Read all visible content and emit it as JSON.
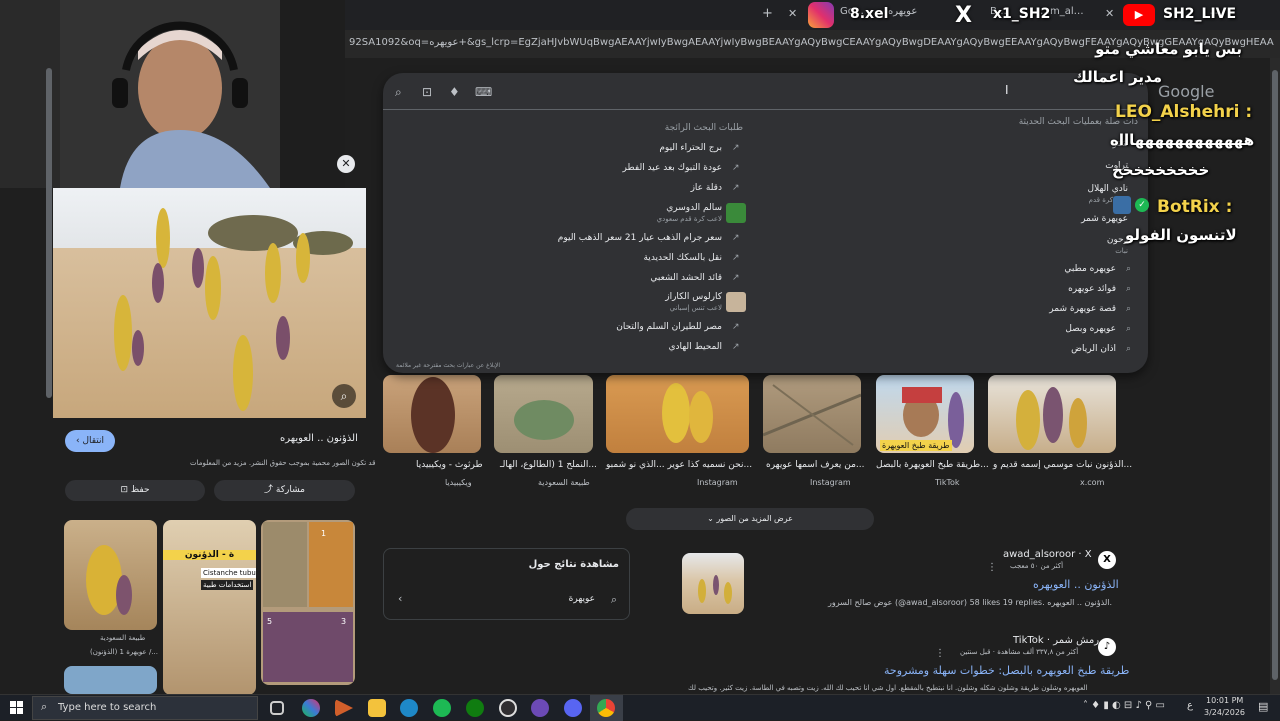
{
  "tabs": [
    {
      "label": "Go…"
    },
    {
      "label": "عويهره"
    },
    {
      "label": "B…"
    },
    {
      "label": "…m_al…"
    }
  ],
  "url": "92SA1092&oq=عويهره+&gs_lcrp=EgZjaHJvbWUqBwgAEAAYjwIyBwgAEAAYjwIyBwgBEAAYgAQyBwgCEAAYgAQyBwgDEAAYgAQyBwgEEAAYgAQyBwgFEAAYgAQyBwgGEAAYgAQyBwgHEAA",
  "stream_overlay": {
    "instagram": "8.xel",
    "x": "x1_SH2",
    "youtube": "SH2_LIVE",
    "chat": [
      {
        "text": "بس يابو معاشي متو"
      },
      {
        "text": "مدير اعمالك"
      },
      {
        "user": "LEO_Alshehri :",
        "text": "ههههههههههههاااه"
      },
      {
        "text": "خخخخخخخخخ"
      },
      {
        "user": "BotRix :",
        "text": "لاتنسون الفولو"
      }
    ],
    "google_watermark": "Google"
  },
  "suggestions": {
    "header_trending": "طلبات البحث الرائجة",
    "header_recent": "ذات صلة بعمليات البحث الحديثة",
    "trending": [
      {
        "text": "برج الحتراء اليوم"
      },
      {
        "text": "عودة التبوك بعد عيد الفطر"
      },
      {
        "text": "دقلة عاز"
      },
      {
        "text": "سالم الدوسري",
        "sub": "لاعب كرة قدم سعودي"
      },
      {
        "text": "سعر جرام الذهب عيار 21 سعر الذهب اليوم"
      },
      {
        "text": "نقل بالسكك الحديدية"
      },
      {
        "text": "قائد الحشد الشعبي"
      },
      {
        "text": "كارلوس الكاراز",
        "sub": "لاعب تنس إسباني"
      },
      {
        "text": "مصر للطيران السلم والتحان"
      },
      {
        "text": "المحيط الهادي"
      }
    ],
    "recent": [
      {
        "text": "شتر"
      },
      {
        "text": "تراوت"
      },
      {
        "text": "نادي الهلال",
        "sub": "نادي كرة قدم"
      },
      {
        "text": "عويهرة شمر"
      },
      {
        "text": "زحون",
        "sub": "نبات"
      },
      {
        "text": "عويهره مطبي"
      },
      {
        "text": "فوائد عويهره"
      },
      {
        "text": "قصة عويهرة شمر"
      },
      {
        "text": "عويهره وبصل"
      },
      {
        "text": "اذان الرياض"
      }
    ],
    "report": "الإبلاغ عن عبارات بحث مقترحة غير ملائمة"
  },
  "image_panel": {
    "title": "الذؤنون .. العويهره",
    "visit_label": "انتقال",
    "copyright": "قد تكون الصور محمية بموجب حقوق النشر. مزيد من المعلومات",
    "save_label": "حفظ",
    "share_label": "مشاركة",
    "related": [
      {
        "caption": "عويهرة 1 (الذؤنون) /...",
        "source": "طبيعة السعودية"
      },
      {
        "caption": "ة - الذؤنون",
        "source": "Cistanche tubulosa"
      },
      {
        "caption": "استخدامات طبية",
        "source": ""
      }
    ]
  },
  "thumbs": [
    {
      "caption": "الذؤنون نبات موسمي إسمه قديم و...",
      "source": "x.com"
    },
    {
      "caption": "طريقة طبخ العويهرة بالبصل...",
      "source": "TikTok",
      "badge": "طريقة طبخ العويهرة"
    },
    {
      "caption": "من يعرف اسمها عويهره...",
      "source": "Instagram"
    },
    {
      "caption": "نحن نسميه كذا عوير ...الذي نو شمبو...",
      "source": "Instagram"
    },
    {
      "caption": "النملح 1 (الطالوع، الهالـ...",
      "source": "طبيعة السعودية"
    },
    {
      "caption": "طرثوث - ويكيبيديا",
      "source": "ويكيبيديا"
    }
  ],
  "more_images": "عرض المزيد من الصور",
  "results": [
    {
      "source": "awad_alsoroor · X",
      "meta": "أكثر من ٥٠ معجب",
      "title": "الذؤنون .. العويهره",
      "snippet": "عوض صالح السرور (@awad_alsoroor) 58 likes 19 replies. الذؤنون .. العويهره."
    },
    {
      "source": "TikTok · رمش شمر",
      "meta": "أكثر من ٣٣٧,٨ ألف مشاهدة · قبل سنتين",
      "title": "طريقة طبخ العويهره بالبصل: خطوات سهلة ومشروحة",
      "snippet": "العويهره وشلون طريقة وشلون شكله وشلون. انا نبتطبخ بالمقطع. اول شي انا تحيب لك الله. زيت وتصبه في الطاسة. زيت كثير. وتحيب لك"
    }
  ],
  "related_box": {
    "title": "مشاهدة نتائج حول",
    "query": "عويهرة"
  },
  "taskbar": {
    "search_placeholder": "Type here to search",
    "time": "10:01 PM",
    "date": "3/24/2026",
    "lang": "ع"
  }
}
